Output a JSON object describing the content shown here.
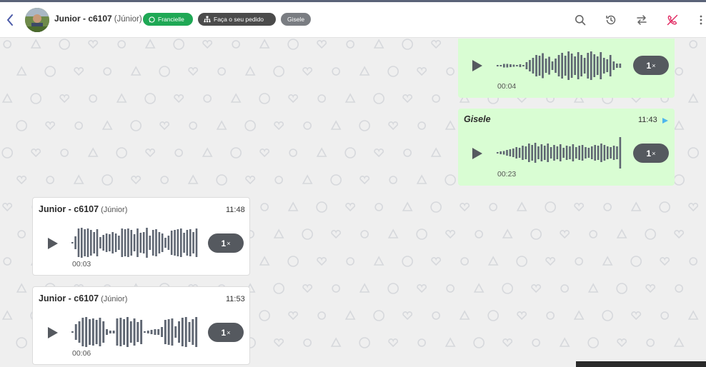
{
  "header": {
    "contact_name": "Junior - c6107",
    "contact_sub": "(Júnior)",
    "tags": {
      "whatsapp": "Francielle",
      "order": "Faça o seu pedido",
      "agent": "Gisele"
    }
  },
  "messages": [
    {
      "sender": "",
      "sub": "",
      "time": "",
      "duration": "00:04",
      "speed": "1",
      "direction": "out"
    },
    {
      "sender": "Gisele",
      "sub": "",
      "time": "11:43",
      "duration": "00:23",
      "speed": "1",
      "direction": "out"
    },
    {
      "sender": "Junior - c6107",
      "sub": "(Júnior)",
      "time": "11:48",
      "duration": "00:03",
      "speed": "1",
      "direction": "in"
    },
    {
      "sender": "Junior - c6107",
      "sub": "(Júnior)",
      "time": "11:53",
      "duration": "00:06",
      "speed": "1",
      "direction": "in"
    }
  ],
  "speed_suffix": "×",
  "colors": {
    "outgoing_bubble": "#d9fdd3",
    "incoming_bubble": "#ffffff",
    "whatsapp_tag": "#1fa855",
    "order_tag": "#4b4b4b",
    "agent_tag": "#7a7d82",
    "speed_button": "#55595f",
    "call_off_icon": "#e0245e",
    "sent_indicator": "#4fb6ec"
  },
  "icons": [
    "back-chevron-icon",
    "whatsapp-icon",
    "sitemap-icon",
    "search-icon",
    "history-icon",
    "transfer-icon",
    "call-off-icon",
    "more-vertical-icon",
    "play-icon",
    "sent-icon"
  ]
}
